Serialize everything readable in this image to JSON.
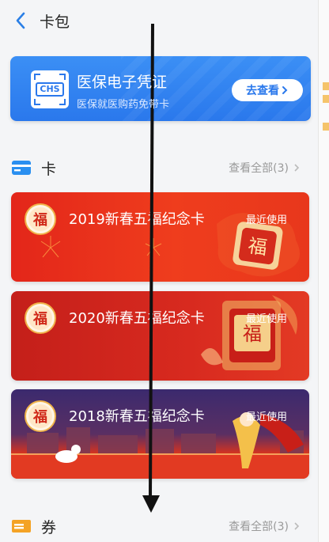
{
  "header": {
    "title": "卡包"
  },
  "medical": {
    "title": "医保电子凭证",
    "subtitle": "医保就医购药免带卡",
    "logo_text": "CHS",
    "button": "去查看",
    "accent": "#2a78ec"
  },
  "cards_section": {
    "label": "卡",
    "more": "查看全部(3)"
  },
  "cards": [
    {
      "title": "2019新春五福纪念卡",
      "tag": "最近使用",
      "badge": "福"
    },
    {
      "title": "2020新春五福纪念卡",
      "tag": "最近使用",
      "badge": "福"
    },
    {
      "title": "2018新春五福纪念卡",
      "tag": "最近使用",
      "badge": "福"
    }
  ],
  "coupons_section": {
    "label": "券",
    "more": "查看全部(3)"
  },
  "icons": [
    "back-arrow-icon",
    "chs-logo-icon",
    "card-icon",
    "coupon-icon",
    "chevron-right-icon",
    "fu-badge-icon",
    "annotation-arrow"
  ]
}
